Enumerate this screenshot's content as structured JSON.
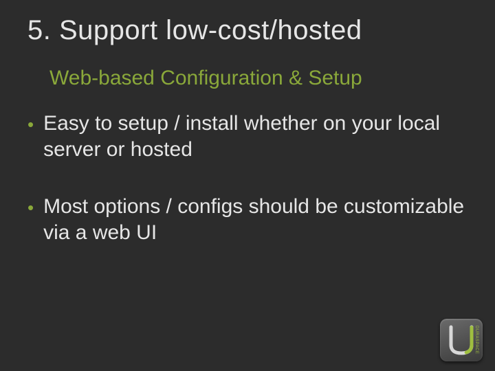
{
  "title": "5. Support low-cost/hosted",
  "subtitle": "Web-based Configuration & Setup",
  "bullets": [
    "Easy to setup / install whether on your local server or hosted",
    "Most options / configs should be customizable via a web UI"
  ],
  "logo": {
    "side_text": "DURASPACE"
  },
  "colors": {
    "accent": "#8aa83a",
    "text": "#e6e6e6",
    "bg": "#2c2c2c"
  }
}
